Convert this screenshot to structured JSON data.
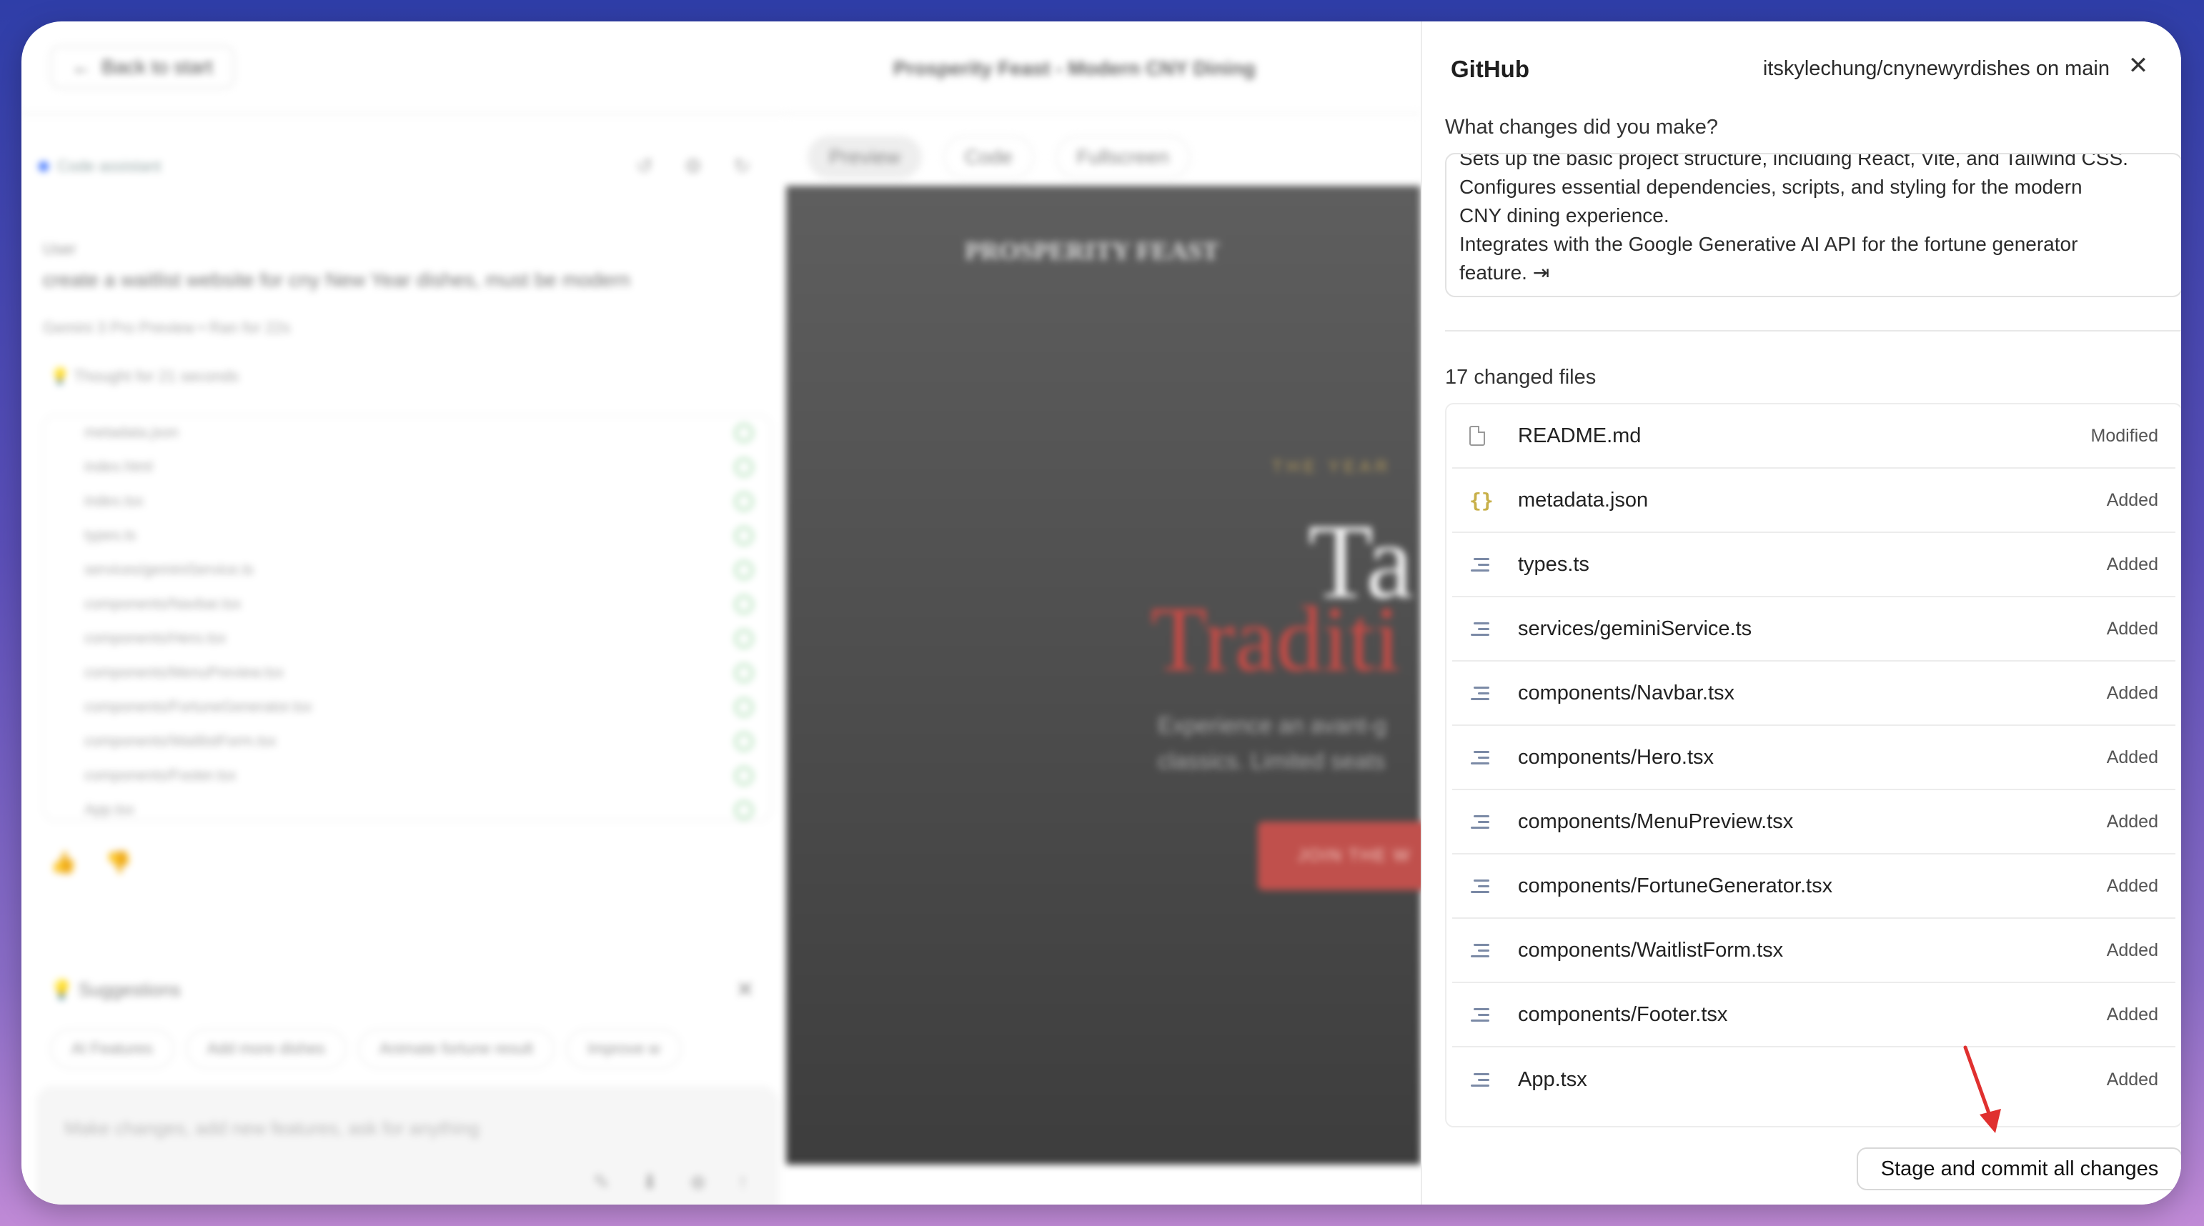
{
  "app": {
    "back_label": "Back to start",
    "project_title": "Prosperity Feast - Modern CNY Dining",
    "assistant_label": "Code assistant",
    "user_label": "User",
    "user_message": "create a waitlist website for cny New Year dishes, must be modern",
    "model_line": "Gemini 3 Pro Preview  •  Ran for 22s",
    "thought": "Thought for 21 seconds",
    "files": [
      "metadata.json",
      "index.html",
      "index.tsx",
      "types.ts",
      "services/geminiService.ts",
      "components/Navbar.tsx",
      "components/Hero.tsx",
      "components/MenuPreview.tsx",
      "components/FortuneGenerator.tsx",
      "components/WaitlistForm.tsx",
      "components/Footer.tsx",
      "App.tsx"
    ],
    "suggestions_label": "Suggestions",
    "chips": [
      "AI Features",
      "Add more dishes",
      "Animate fortune result",
      "Improve w"
    ],
    "prompt_placeholder": "Make changes, add new features, ask for anything",
    "tabs": [
      "Preview",
      "Code",
      "Fullscreen"
    ],
    "preview": {
      "logo": "PROSPERITY FEAST",
      "year": "THE YEAR",
      "ta": "Ta",
      "trad": "Traditi",
      "sub1": "Experience an avant-g",
      "sub2": "classics. Limited seats",
      "cta": "JOIN THE W"
    }
  },
  "github": {
    "title": "GitHub",
    "repo": "itskylechung/cnynewyrdishes on main",
    "question": "What changes did you make?",
    "message_lines": [
      "Sets up the basic project structure, including React, Vite, and Tailwind CSS.",
      "Configures essential dependencies, scripts, and styling for the modern",
      "CNY dining experience.",
      "Integrates with the Google Generative AI API for the fortune generator",
      "feature. ⇥"
    ],
    "changed_count": "17 changed files",
    "files": [
      {
        "name": "README.md",
        "status": "Modified",
        "icon": "doc-icon"
      },
      {
        "name": "metadata.json",
        "status": "Added",
        "icon": "braces-icon"
      },
      {
        "name": "types.ts",
        "status": "Added",
        "icon": "lines-icon"
      },
      {
        "name": "services/geminiService.ts",
        "status": "Added",
        "icon": "lines-icon"
      },
      {
        "name": "components/Navbar.tsx",
        "status": "Added",
        "icon": "lines-icon"
      },
      {
        "name": "components/Hero.tsx",
        "status": "Added",
        "icon": "lines-icon"
      },
      {
        "name": "components/MenuPreview.tsx",
        "status": "Added",
        "icon": "lines-icon"
      },
      {
        "name": "components/FortuneGenerator.tsx",
        "status": "Added",
        "icon": "lines-icon"
      },
      {
        "name": "components/WaitlistForm.tsx",
        "status": "Added",
        "icon": "lines-icon"
      },
      {
        "name": "components/Footer.tsx",
        "status": "Added",
        "icon": "lines-icon"
      },
      {
        "name": "App.tsx",
        "status": "Added",
        "icon": "lines-icon"
      }
    ],
    "commit_label": "Stage and commit all changes",
    "arrow_color": "#e0302f"
  }
}
